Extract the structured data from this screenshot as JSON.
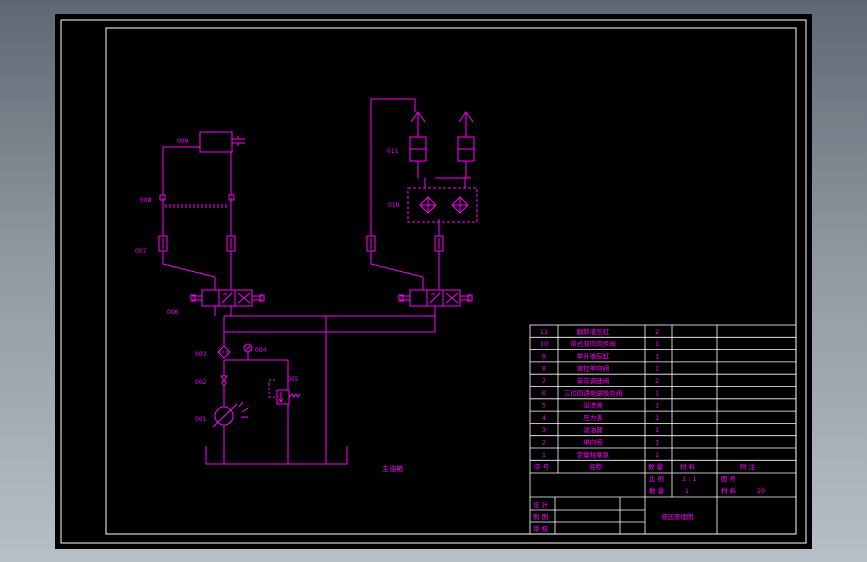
{
  "colors": {
    "background": "#000000",
    "frame": "#ffffff",
    "circuit": "#ff00ff",
    "table_text": "#ff00ff",
    "table_lines": "#ffffff"
  },
  "components": {
    "c001": "001",
    "c002": "002",
    "c003": "003",
    "c004": "004",
    "c005": "005",
    "c006": "006",
    "c007": "007",
    "c008": "008",
    "c009": "009",
    "c010": "010",
    "c011": "011"
  },
  "tank_label": "主油箱",
  "parts_list": {
    "rows": [
      {
        "no": "11",
        "name": "翻转液压缸",
        "qty": "2"
      },
      {
        "no": "10",
        "name": "带式双向同步阀",
        "qty": "1"
      },
      {
        "no": "9",
        "name": "举升液压缸",
        "qty": "1"
      },
      {
        "no": "8",
        "name": "液控单向阀",
        "qty": "1"
      },
      {
        "no": "7",
        "name": "单向调速阀",
        "qty": "2"
      },
      {
        "no": "6",
        "name": "三位四通电磁换向阀",
        "qty": "1"
      },
      {
        "no": "5",
        "name": "溢流阀",
        "qty": "1"
      },
      {
        "no": "4",
        "name": "压力表",
        "qty": "1"
      },
      {
        "no": "3",
        "name": "滤油器",
        "qty": "1"
      },
      {
        "no": "2",
        "name": "单向阀",
        "qty": "1"
      },
      {
        "no": "1",
        "name": "定量柱塞泵",
        "qty": "1"
      }
    ],
    "header": {
      "no": "序 号",
      "name": "名称",
      "qty": "数 量",
      "material": "材 料",
      "remark": "附 注"
    }
  },
  "title_block": {
    "scale_label": "比 例",
    "scale_value": "1 : 1",
    "drawing_no_label": "图 号",
    "qty_label": "数 量",
    "qty_value": "1",
    "material_label": "材 料",
    "material_value": "20",
    "designed": "设 计",
    "drawn": "制 图",
    "checked": "审 核",
    "drawing_title": "液压原理图"
  }
}
